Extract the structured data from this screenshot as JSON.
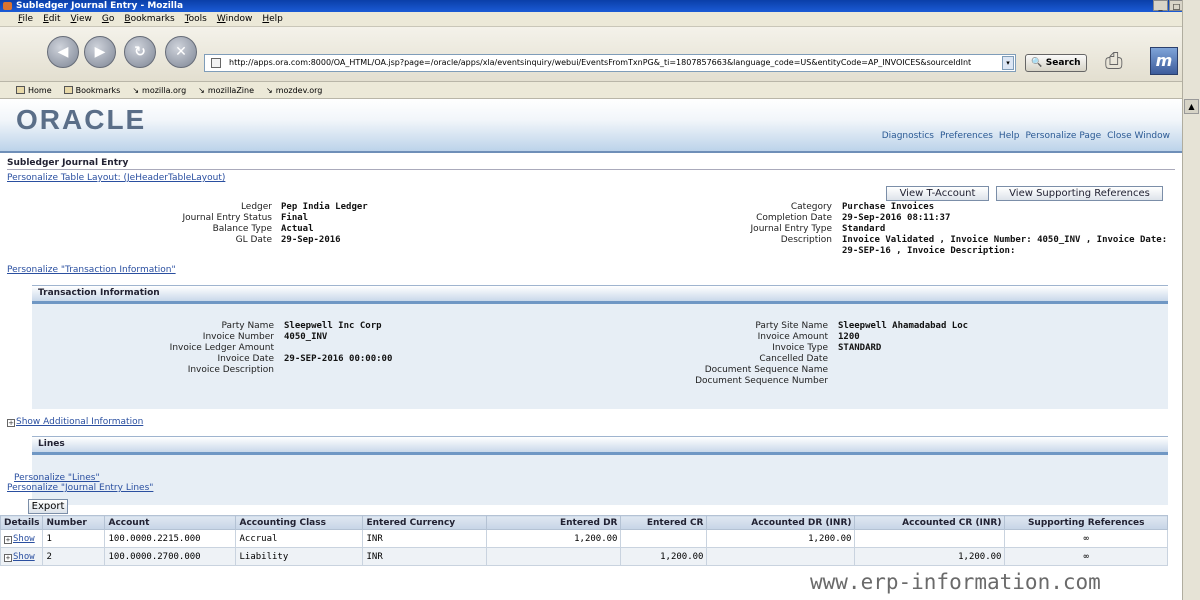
{
  "window": {
    "title": "Subledger Journal Entry - Mozilla",
    "controls": [
      "_",
      "□",
      "×"
    ]
  },
  "menu": [
    "File",
    "Edit",
    "View",
    "Go",
    "Bookmarks",
    "Tools",
    "Window",
    "Help"
  ],
  "toolbar": {
    "url": "http://apps.ora.com:8000/OA_HTML/OA.jsp?page=/oracle/apps/xla/eventsinquiry/webui/EventsFromTxnPG&_ti=1807857663&language_code=US&entityCode=AP_INVOICES&sourceIdInt",
    "search_label": "Search"
  },
  "bookmarks": [
    "Home",
    "Bookmarks",
    "mozilla.org",
    "mozillaZine",
    "mozdev.org"
  ],
  "brand": {
    "logo": "ORACLE",
    "global_links": [
      "Diagnostics",
      "Preferences",
      "Help",
      "Personalize Page",
      "Close Window"
    ]
  },
  "page": {
    "title": "Subledger Journal Entry",
    "personalize_table": "Personalize Table Layout: (JeHeaderTableLayout)",
    "personalize_txn": "Personalize \"Transaction Information\"",
    "buttons": {
      "view_t_account": "View T-Account",
      "view_supporting": "View Supporting References"
    }
  },
  "header": {
    "left": [
      {
        "label": "Ledger",
        "value": "Pep India Ledger"
      },
      {
        "label": "Journal Entry Status",
        "value": "Final"
      },
      {
        "label": "Balance Type",
        "value": "Actual"
      },
      {
        "label": "GL Date",
        "value": "29-Sep-2016"
      }
    ],
    "right": [
      {
        "label": "Category",
        "value": "Purchase Invoices"
      },
      {
        "label": "Completion Date",
        "value": "29-Sep-2016 08:11:37"
      },
      {
        "label": "Journal Entry Type",
        "value": "Standard"
      },
      {
        "label": "Description",
        "value": "Invoice Validated , Invoice Number: 4050_INV , Invoice Date:"
      },
      {
        "label": "",
        "value": "29-SEP-16 , Invoice Description:"
      }
    ]
  },
  "transaction": {
    "title": "Transaction Information",
    "left": [
      {
        "label": "Party Name",
        "value": "Sleepwell Inc Corp"
      },
      {
        "label": "Invoice Number",
        "value": "4050_INV"
      },
      {
        "label": "Invoice Ledger Amount",
        "value": ""
      },
      {
        "label": "Invoice Date",
        "value": "29-SEP-2016 00:00:00"
      },
      {
        "label": "Invoice Description",
        "value": ""
      }
    ],
    "right": [
      {
        "label": "Party Site Name",
        "value": "Sleepwell Ahamadabad Loc"
      },
      {
        "label": "Invoice Amount",
        "value": "1200"
      },
      {
        "label": "Invoice Type",
        "value": "STANDARD"
      },
      {
        "label": "Cancelled Date",
        "value": ""
      },
      {
        "label": "Document Sequence Name",
        "value": ""
      },
      {
        "label": "Document Sequence Number",
        "value": ""
      }
    ],
    "show_additional": "Show Additional Information"
  },
  "lines": {
    "title": "Lines",
    "personalize_lines": "Personalize \"Lines\"",
    "personalize_journal_lines": "Personalize \"Journal Entry Lines\"",
    "export_label": "Export",
    "columns": [
      "Details",
      "Number",
      "Account",
      "Accounting Class",
      "Entered Currency",
      "Entered DR",
      "Entered CR",
      "Accounted DR (INR)",
      "Accounted CR (INR)",
      "Supporting References"
    ],
    "rows": [
      {
        "details": "Show",
        "number": "1",
        "account": "100.0000.2215.000",
        "class": "Accrual",
        "currency": "INR",
        "entered_dr": "1,200.00",
        "entered_cr": "",
        "acc_dr": "1,200.00",
        "acc_cr": "",
        "ref": "∞"
      },
      {
        "details": "Show",
        "number": "2",
        "account": "100.0000.2700.000",
        "class": "Liability",
        "currency": "INR",
        "entered_dr": "",
        "entered_cr": "1,200.00",
        "acc_dr": "",
        "acc_cr": "1,200.00",
        "ref": "∞"
      }
    ]
  },
  "watermark": "www.erp-information.com"
}
